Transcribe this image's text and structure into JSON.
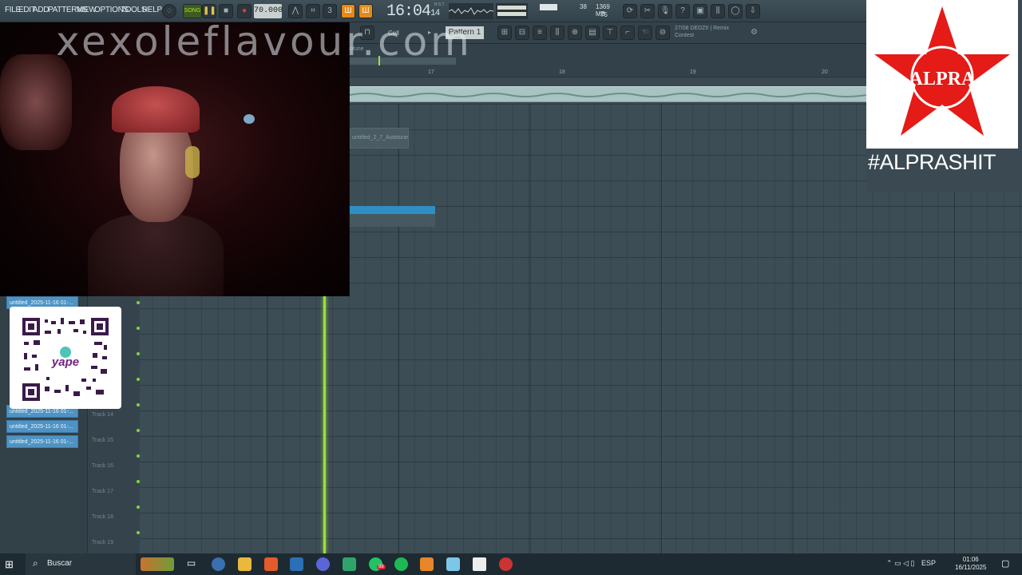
{
  "menu": [
    "FILE",
    "EDIT",
    "ADD",
    "PATTERNS",
    "VIEW",
    "OPTIONS",
    "TOOLS",
    "HELP"
  ],
  "transport": {
    "song_label": "SONG",
    "tempo": "70.000",
    "time": "16:04",
    "time_ticks": "14",
    "time_unit": "B:S:T"
  },
  "cpu": {
    "mem": "1369 MB",
    "cpu_val": "38",
    "poly": "75"
  },
  "toolbar2": {
    "snap": "Cell",
    "pattern": "Pattern 1"
  },
  "hint": {
    "line1": "27/08  DEDZII | Remix",
    "line2": "Contest"
  },
  "ruler": {
    "marks": [
      "17",
      "18",
      "19",
      "20"
    ],
    "track_label": "otune"
  },
  "clips": {
    "clip1": "untitled_2_7_Autotune"
  },
  "overlay": {
    "watermark": "xexoleflavour.com",
    "qr_label": "yape",
    "logo_text": "ALPRA",
    "hashtag": "#ALPRASHIT"
  },
  "playlist": {
    "items": [
      "untitled_2025-11-16 01-...",
      "untitled_2025-11-16 01-...",
      "untitled_2025-11-16 01-...",
      "untitled_2025-11-16 01-..."
    ],
    "tracks": [
      "Track 14",
      "Track 15",
      "Track 16",
      "Track 17",
      "Track 18",
      "Track 19"
    ]
  },
  "taskbar": {
    "search": "Buscar",
    "badge": "88",
    "lang": "ESP",
    "time": "01:06",
    "date": "16/11/2025"
  },
  "colors": {
    "accent_orange": "#e58a16",
    "playhead": "#9ce03a",
    "clip_blue": "#2f8fc4",
    "logo_red": "#e41b17"
  }
}
